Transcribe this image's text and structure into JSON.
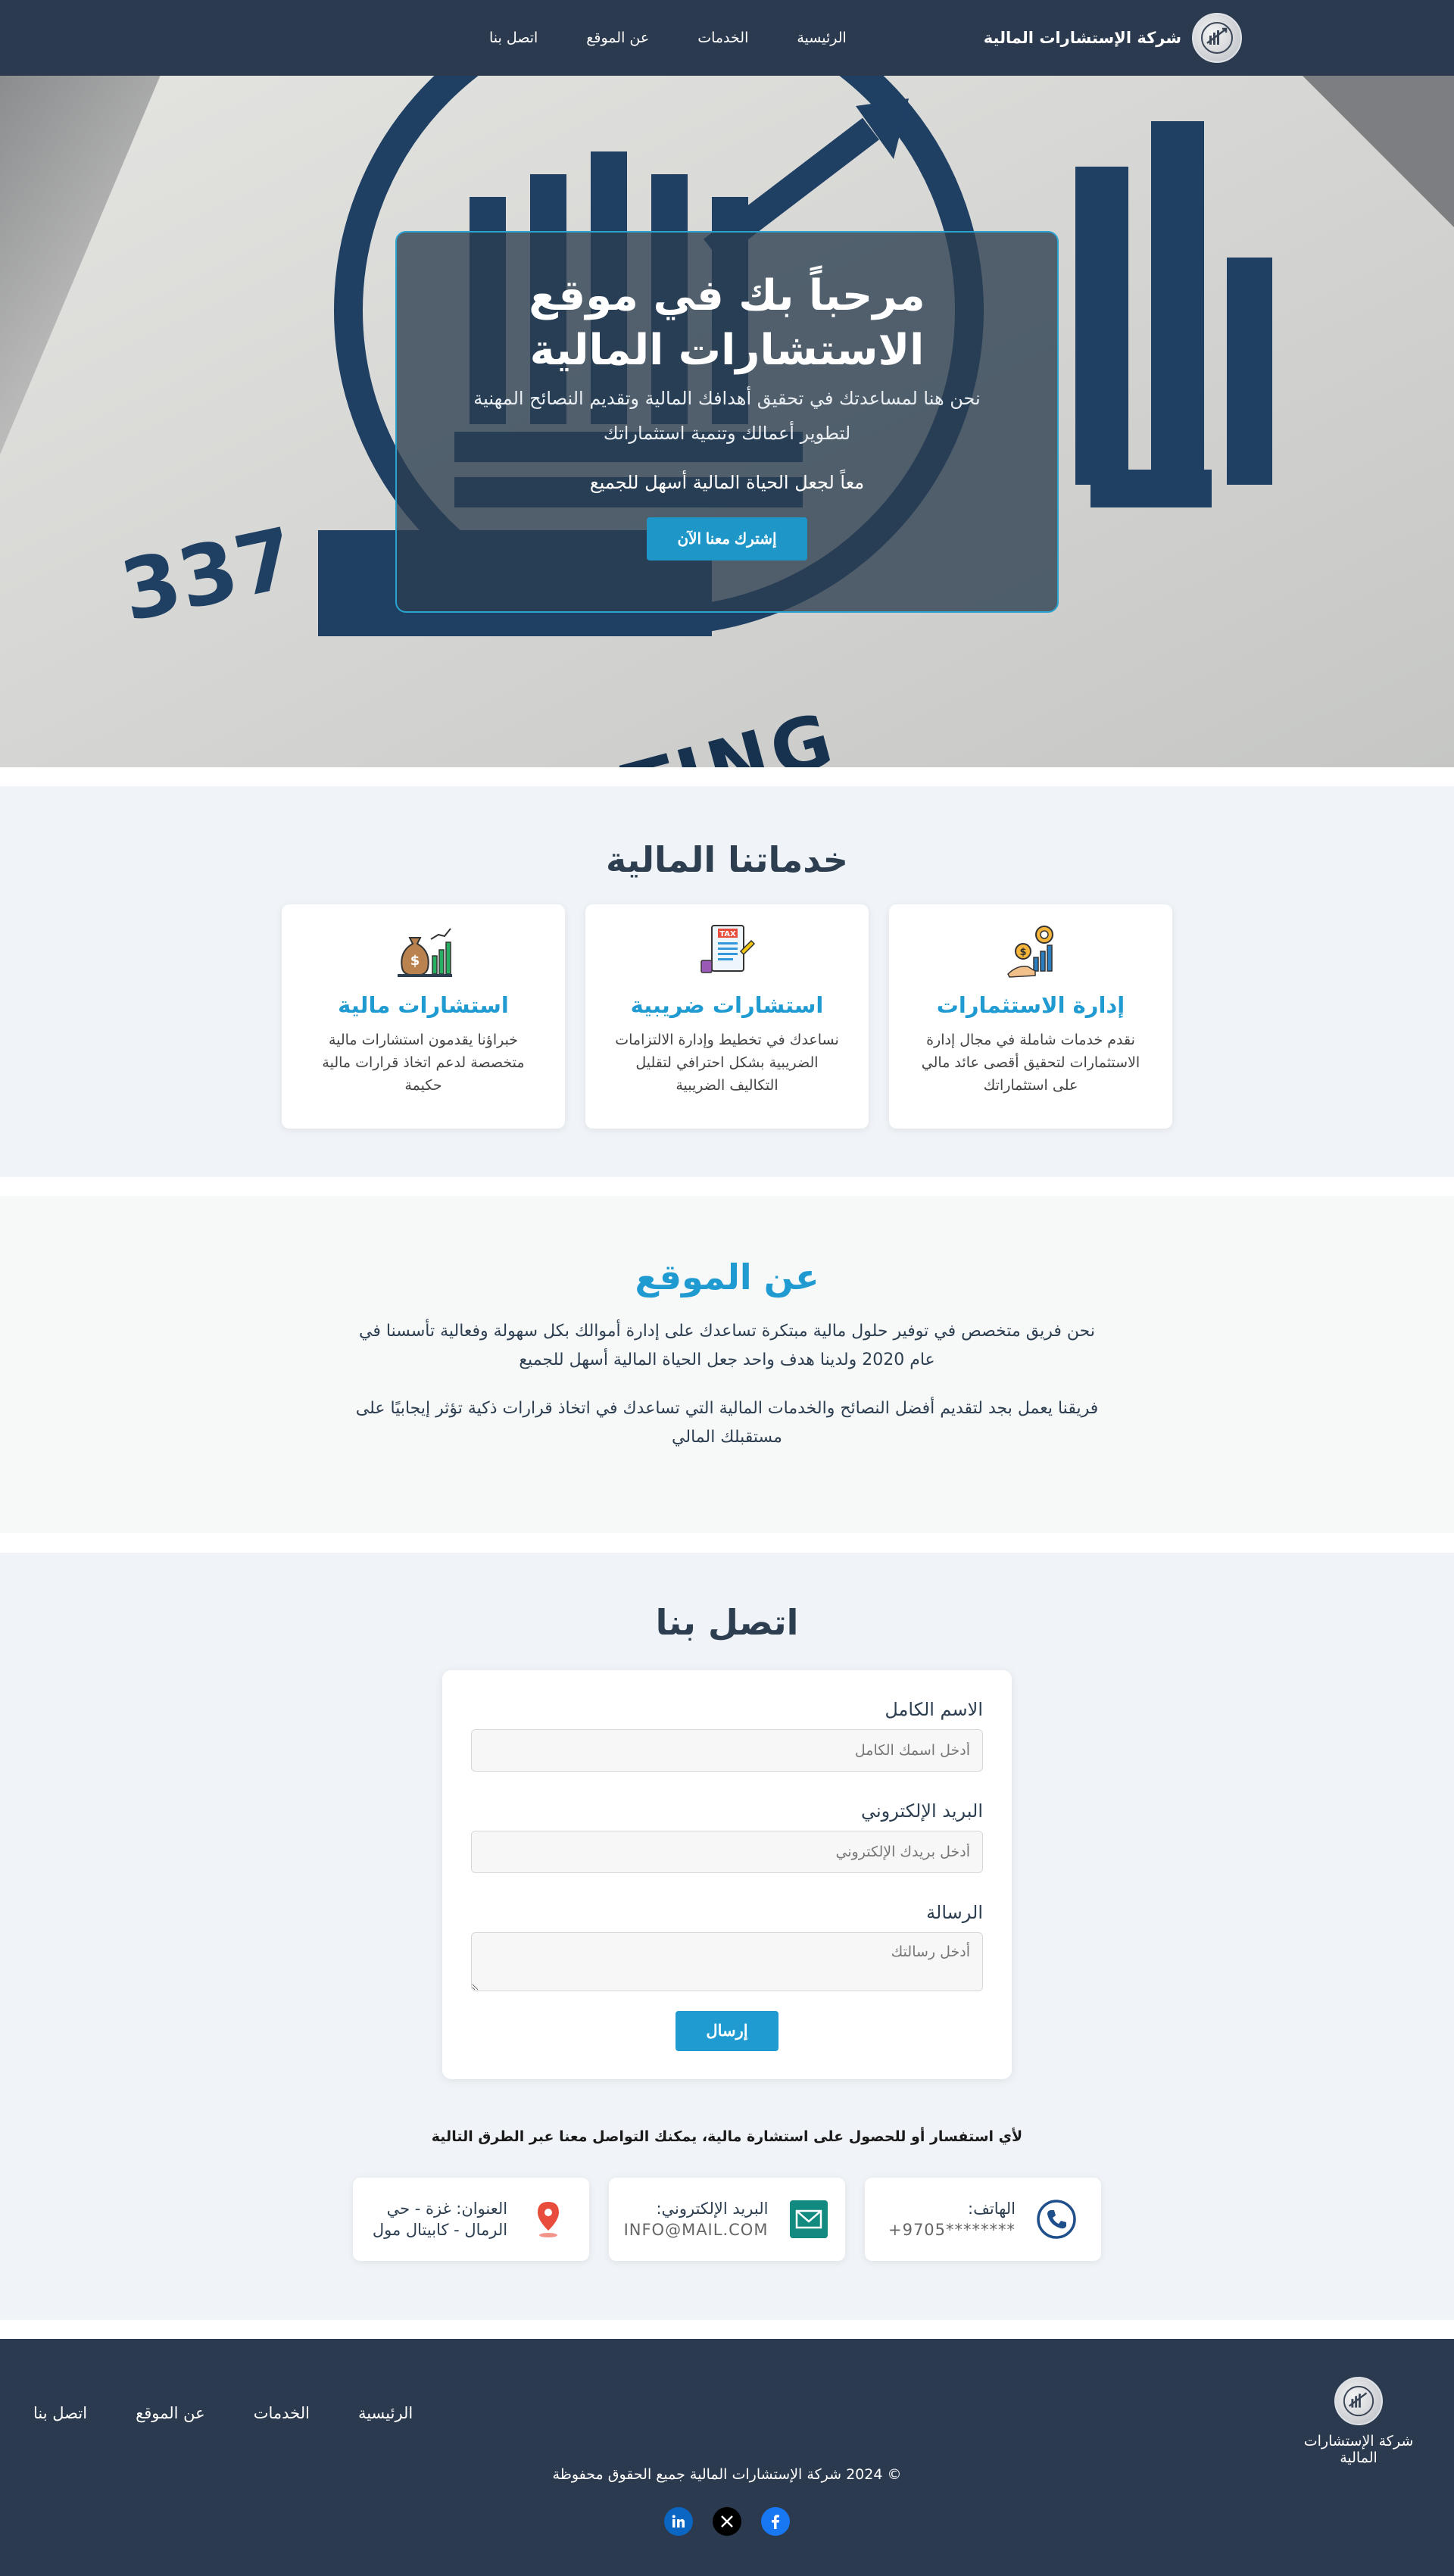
{
  "navbar": {
    "brand_name": "شركة الإستشارات المالية",
    "links": [
      "الرئيسية",
      "الخدمات",
      "عن الموقع",
      "اتصل بنا"
    ]
  },
  "hero": {
    "title": "مرحباً بك في موقع الاستشارات المالية",
    "subtitle": "نحن هنا لمساعدتك في تحقيق أهدافك المالية وتقديم النصائح المهنية لتطوير أعمالك وتنمية استثماراتك",
    "motto": "معاً لجعل الحياة المالية أسهل للجميع",
    "cta": "إشترك معنا الآن",
    "background_text": "337",
    "background_banner": "L CONSULTING"
  },
  "services": {
    "title": "خدماتنا المالية",
    "cards": [
      {
        "icon": "investment-icon",
        "title": "إدارة الاستثمارات",
        "desc": "نقدم خدمات شاملة في مجال إدارة الاستثمارات لتحقيق أقصى عائد مالي على استثماراتك"
      },
      {
        "icon": "tax-icon",
        "title": "استشارات ضريبية",
        "desc": "نساعدك في تخطيط وإدارة الالتزامات الضريبية بشكل احترافي لتقليل التكاليف الضريبية"
      },
      {
        "icon": "money-bag-icon",
        "title": "استشارات مالية",
        "desc": "خبراؤنا يقدمون استشارات مالية متخصصة لدعم اتخاذ قرارات مالية حكيمة"
      }
    ]
  },
  "about": {
    "title": "عن الموقع",
    "p1": "نحن فريق متخصص في توفير حلول مالية مبتكرة تساعدك على إدارة أموالك بكل سهولة وفعالية تأسسنا في عام 2020 ولدينا هدف واحد جعل الحياة المالية أسهل للجميع",
    "p2": "فريقنا يعمل بجد لتقديم أفضل النصائح والخدمات المالية التي تساعدك في اتخاذ قرارات ذكية تؤثر إيجابيًا على مستقبلك المالي"
  },
  "contact": {
    "title": "اتصل بنا",
    "name_label": "الاسم الكامل",
    "name_placeholder": "أدخل اسمك الكامل",
    "email_label": "البريد الإلكتروني",
    "email_placeholder": "أدخل بريدك الإلكتروني",
    "message_label": "الرسالة",
    "message_placeholder": "أدخل رسالتك",
    "submit": "إرسال",
    "note": "لأي استفسار أو للحصول على استشارة مالية، يمكنك التواصل معنا عبر الطرق التالية",
    "info": {
      "phone_label": "الهاتف:",
      "phone_value": "+9705********",
      "email_label": "البريد الإلكتروني:",
      "email_value": "INFO@MAIL.COM",
      "address_label": "العنوان: غزة - حي",
      "address_value": "الرمال - كابيتال مول"
    }
  },
  "footer": {
    "brand_name": "شركة الإستشارات المالية",
    "links": [
      "الرئيسية",
      "الخدمات",
      "عن الموقع",
      "اتصل بنا"
    ],
    "copyright": "© 2024 شركة الإستشارات المالية جميع الحقوق محفوظة",
    "socials": [
      "facebook-icon",
      "x-icon",
      "linkedin-icon"
    ]
  },
  "colors": {
    "navy": "#2c3a4f",
    "accent": "#1f9bd1",
    "section_bg": "#f0f4f8"
  }
}
